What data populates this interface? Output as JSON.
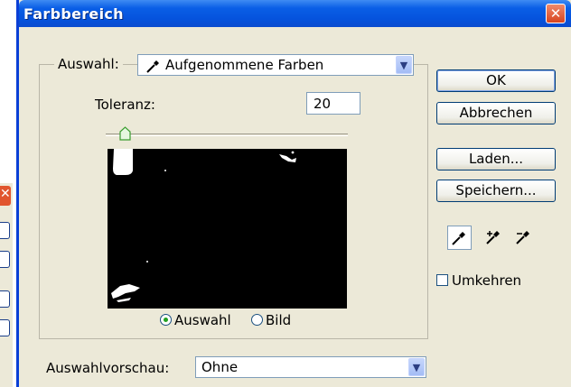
{
  "window": {
    "title": "Farbbereich",
    "close_glyph": "✕"
  },
  "selection": {
    "label": "Auswahl:",
    "value": "Aufgenommene Farben"
  },
  "tolerance": {
    "label": "Toleranz:",
    "value": "20",
    "level_fraction": 0.07
  },
  "view_mode": {
    "options": [
      "Auswahl",
      "Bild"
    ],
    "selected": "Auswahl"
  },
  "preview_mode": {
    "label": "Auswahlvorschau:",
    "value": "Ohne"
  },
  "buttons": {
    "ok": "OK",
    "cancel": "Abbrechen",
    "load": "Laden...",
    "save": "Speichern..."
  },
  "tools": [
    "eyedropper-icon",
    "eyedropper-plus-icon",
    "eyedropper-minus-icon"
  ],
  "invert": {
    "label": "Umkehren",
    "checked": false
  },
  "colors": {
    "titlebar": "#0553dd",
    "dialog_bg": "#ece9d8",
    "close": "#d8441f",
    "preview_bg": "#000000",
    "radio_on": "#21a121"
  }
}
